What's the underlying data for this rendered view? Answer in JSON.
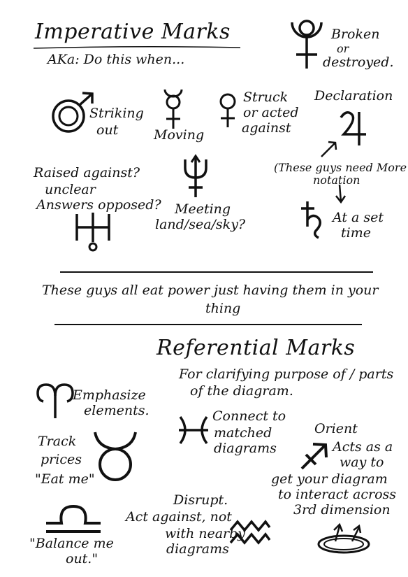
{
  "headings": {
    "imperative": "Imperative Marks",
    "imperative_sub": "AKa: Do this when...",
    "referential": "Referential Marks",
    "referential_sub_1": "For clarifying purpose of / parts",
    "referential_sub_2": "of the diagram."
  },
  "imperative_marks": {
    "broken_1": "Broken",
    "broken_2": "or",
    "broken_3": "destroyed.",
    "striking_1": "Striking",
    "striking_2": "out",
    "moving": "Moving",
    "struck_1": "Struck",
    "struck_2": "or acted",
    "struck_3": "against",
    "declaration": "Declaration",
    "raised_1": "Raised against?",
    "raised_2": "unclear",
    "raised_3": "Answers opposed?",
    "meeting_1": "Meeting",
    "meeting_2": "land/sea/sky?",
    "need_1": "(These guys need More",
    "need_2": "notation",
    "set_time_1": "At a set",
    "set_time_2": "time"
  },
  "note": {
    "line_1": "These guys all eat power just having them in your",
    "line_2": "thing"
  },
  "referential_marks": {
    "emphasize_1": "Emphasize",
    "emphasize_2": "elements.",
    "connect_1": "Connect to",
    "connect_2": "matched",
    "connect_3": "diagrams",
    "orient": "Orient",
    "orient_1": "Acts as a",
    "orient_2": "way to",
    "orient_3": "get your diagram",
    "orient_4": "to interact across",
    "orient_5": "3rd dimension",
    "track_1": "Track",
    "track_2": "prices",
    "track_3": "\"Eat me\"",
    "disrupt_1": "Disrupt.",
    "disrupt_2": "Act against, not",
    "disrupt_3": "with nearby",
    "disrupt_4": "diagrams",
    "balance_1": "\"Balance me",
    "balance_2": "out.\""
  },
  "icons": [
    "pluto-icon",
    "mars-icon",
    "mercury-icon",
    "venus-icon",
    "jupiter-icon",
    "neptune-icon",
    "uranus-icon",
    "saturn-icon",
    "aries-icon",
    "pisces-icon",
    "sagittarius-icon",
    "taurus-icon",
    "libra-icon",
    "aquarius-icon",
    "ring-arrows-icon"
  ]
}
